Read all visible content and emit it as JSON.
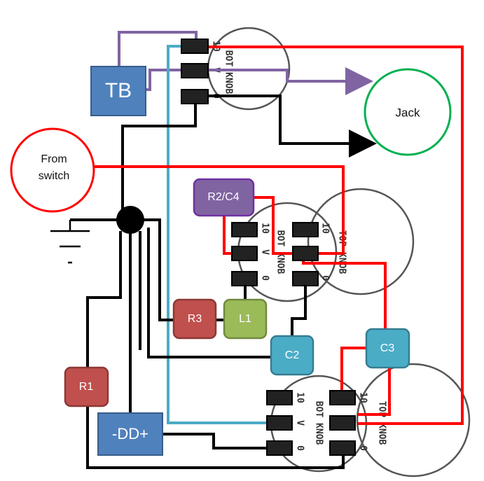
{
  "components": {
    "tb": "TB",
    "jack": "Jack",
    "from_switch": [
      "From",
      "switch"
    ],
    "r2c4": "R2/C4",
    "r3": "R3",
    "l1": "L1",
    "c2": "C2",
    "c3": "C3",
    "r1": "R1",
    "dd": "-DD+"
  },
  "pots": {
    "bot_knob": "BOT KNOB",
    "top_knob": "TOP KNOB",
    "pin_10": "10",
    "pin_v": "V",
    "pin_0": "0"
  },
  "colors": {
    "red_wire": "#ff0000",
    "purple_wire": "#8064a2",
    "cyan_wire": "#4bacc6",
    "black_wire": "#000000",
    "blue_box": "#4f81bd",
    "red_box": "#c0504d",
    "green_box": "#9bbb59",
    "teal_box": "#4bacc6",
    "purple_box": "#8064a2",
    "jack_ring": "#00b050"
  }
}
